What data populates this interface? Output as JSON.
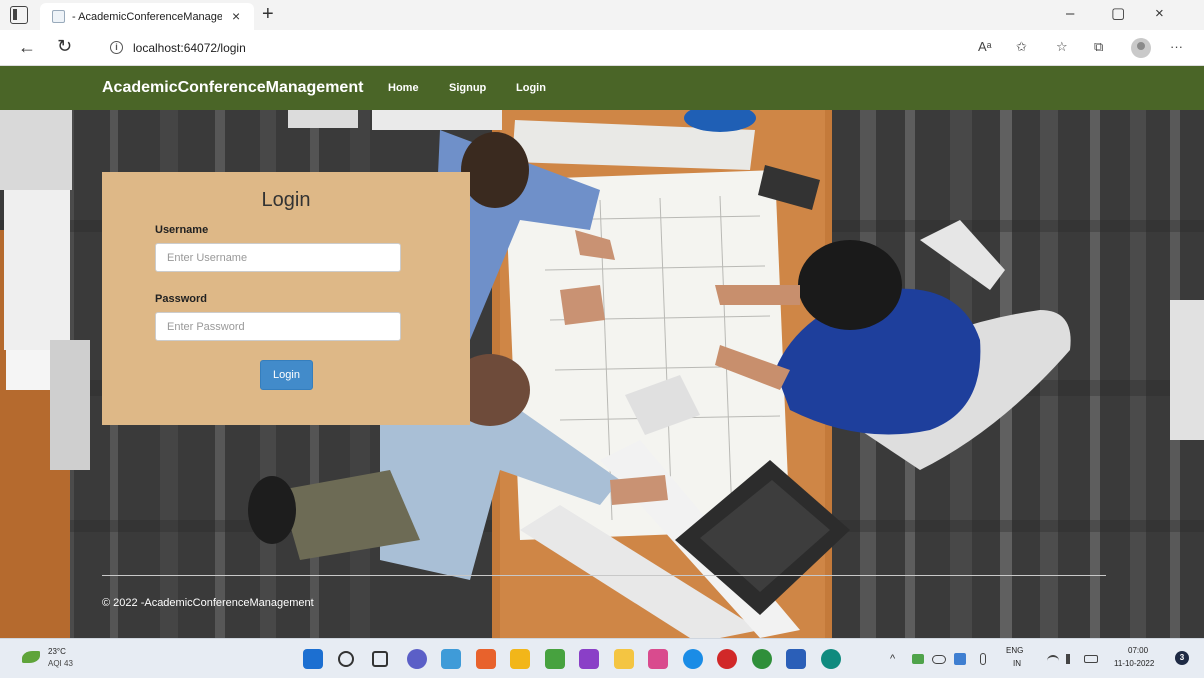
{
  "browser": {
    "tab_title": "- AcademicConferenceManagem",
    "url": "localhost:64072/login",
    "controls": {
      "tab_close": "×",
      "new_tab": "+",
      "minimize": "–",
      "maximize": "▢",
      "close": "×",
      "back": "←",
      "reload": "↻",
      "read_aloud": "Aᵃ",
      "add_favorite": "✩",
      "favorites": "☆",
      "collections": "⧉",
      "menu": "···"
    }
  },
  "navbar": {
    "brand": "AcademicConferenceManagement",
    "links": [
      "Home",
      "Signup",
      "Login"
    ]
  },
  "login": {
    "title": "Login",
    "username_label": "Username",
    "username_placeholder": "Enter Username",
    "password_label": "Password",
    "password_placeholder": "Enter Password",
    "submit_label": "Login"
  },
  "footer": {
    "text": "© 2022 -AcademicConferenceManagement"
  },
  "taskbar": {
    "weather_temp": "23°C",
    "weather_aqi": "AQI 43",
    "lang_line1": "ENG",
    "lang_line2": "IN",
    "time": "07:00",
    "date": "11-10-2022",
    "notification_count": "3",
    "tray_chevron": "^",
    "pinned_apps": [
      {
        "icon": "windows-start-icon",
        "color": "#1c6fd1"
      },
      {
        "icon": "search-icon",
        "color": "#333333"
      },
      {
        "icon": "task-view-icon",
        "color": "#333333"
      },
      {
        "icon": "chat-icon",
        "color": "#5b5fc7"
      },
      {
        "icon": "snipping-icon",
        "color": "#3f9bd8"
      },
      {
        "icon": "network-app-icon",
        "color": "#e8622c"
      },
      {
        "icon": "notes-icon",
        "color": "#f2b619"
      },
      {
        "icon": "paint-icon",
        "color": "#47a23f"
      },
      {
        "icon": "visual-studio-icon",
        "color": "#8a3fc7"
      },
      {
        "icon": "file-explorer-icon",
        "color": "#f4c542"
      },
      {
        "icon": "photos-icon",
        "color": "#d94b8e"
      },
      {
        "icon": "skype-icon",
        "color": "#1a8ce6"
      },
      {
        "icon": "recorder-icon",
        "color": "#d12828"
      },
      {
        "icon": "chrome-icon",
        "color": "#2f8f3a"
      },
      {
        "icon": "word-icon",
        "color": "#2b5fb8"
      },
      {
        "icon": "edge-icon",
        "color": "#0f8a7e"
      }
    ]
  }
}
